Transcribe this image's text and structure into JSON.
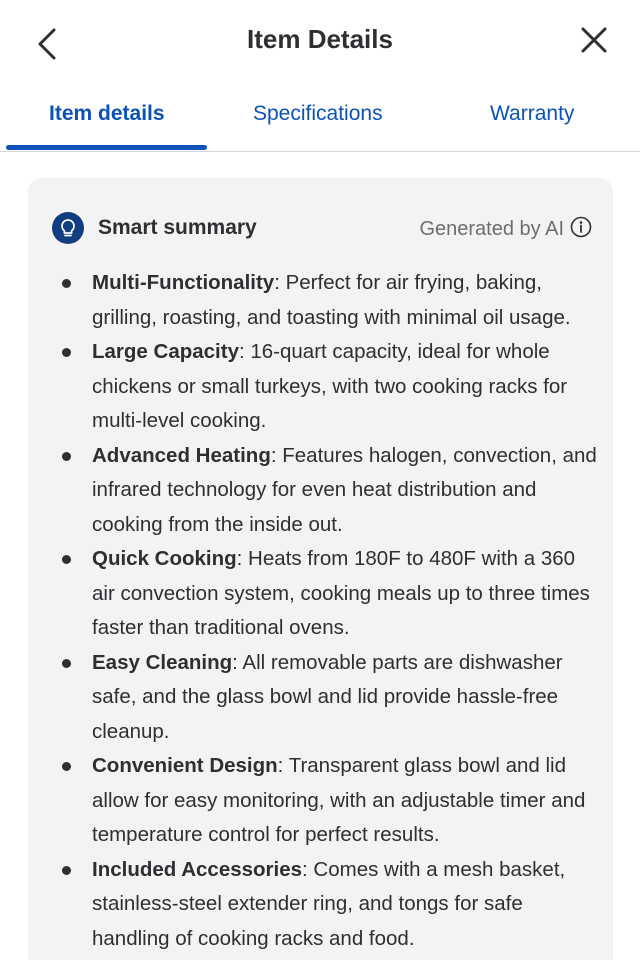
{
  "header": {
    "title": "Item Details",
    "back_icon": "chevron-left-icon",
    "close_icon": "close-icon"
  },
  "tabs": [
    {
      "label": "Item details",
      "active": true
    },
    {
      "label": "Specifications",
      "active": false
    },
    {
      "label": "Warranty",
      "active": false
    }
  ],
  "summary": {
    "icon": "lightbulb-icon",
    "title": "Smart summary",
    "generated_label": "Generated by AI",
    "info_icon": "info-icon",
    "items": [
      {
        "term": "Multi-Functionality",
        "text": ": Perfect for air frying, baking, grilling, roasting, and toasting with minimal oil usage."
      },
      {
        "term": "Large Capacity",
        "text": ": 16-quart capacity, ideal for whole chickens or small turkeys, with two cooking racks for multi-level cooking."
      },
      {
        "term": "Advanced Heating",
        "text": ": Features halogen, convection, and infrared technology for even heat distribution and cooking from the inside out."
      },
      {
        "term": "Quick Cooking",
        "text": ": Heats from 180F to 480F with a 360 air convection system, cooking meals up to three times faster than traditional ovens."
      },
      {
        "term": "Easy Cleaning",
        "text": ": All removable parts are dishwasher safe, and the glass bowl and lid provide hassle-free cleanup."
      },
      {
        "term": "Convenient Design",
        "text": ": Transparent glass bowl and lid allow for easy monitoring, with an adjustable timer and temperature control for perfect results."
      },
      {
        "term": "Included Accessories",
        "text": ": Comes with a mesh basket, stainless-steel extender ring, and tongs for safe handling of cooking racks and food."
      }
    ]
  },
  "colors": {
    "accent": "#0a52b8",
    "icon_bg": "#123e80",
    "card_bg": "#f3f3f4",
    "text": "#2e2f32",
    "muted": "#6d6e71"
  }
}
